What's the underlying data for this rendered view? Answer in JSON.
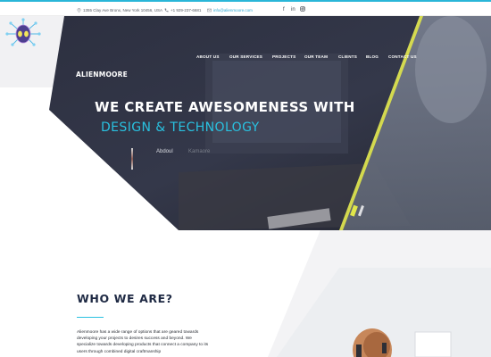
{
  "topbar": {
    "address": "1355 Clay Ave Bronx, New York 10456, USA",
    "phone": "+1 929-237-6681",
    "email": "info@alienmoore.com",
    "social": [
      "f",
      "in",
      "ig"
    ]
  },
  "brand": {
    "name": "ALIENMOORE"
  },
  "nav": {
    "items": [
      "ABOUT US",
      "OUR SERVICES",
      "PROJECTS",
      "OUR TEAM",
      "CLIENTS",
      "BLOG",
      "CONTACT US"
    ]
  },
  "hero": {
    "headline": "WE CREATE AWESOMENESS WITH",
    "subline": "DESIGN & TECHNOLOGY",
    "names": [
      "Abdoul",
      "Kamaore"
    ]
  },
  "about": {
    "title": "WHO WE ARE?",
    "text": "Alienmoore has a wide range of options that are geared towards developing your projects to desires success and beyond. We specialize towards developing products that connect a company to its users through combined digital craftmanship"
  },
  "colors": {
    "accent": "#29c1e0",
    "dark": "#1f2a44",
    "hero_overlay": "#2a2d3d",
    "stripe": "#e0e64a"
  }
}
